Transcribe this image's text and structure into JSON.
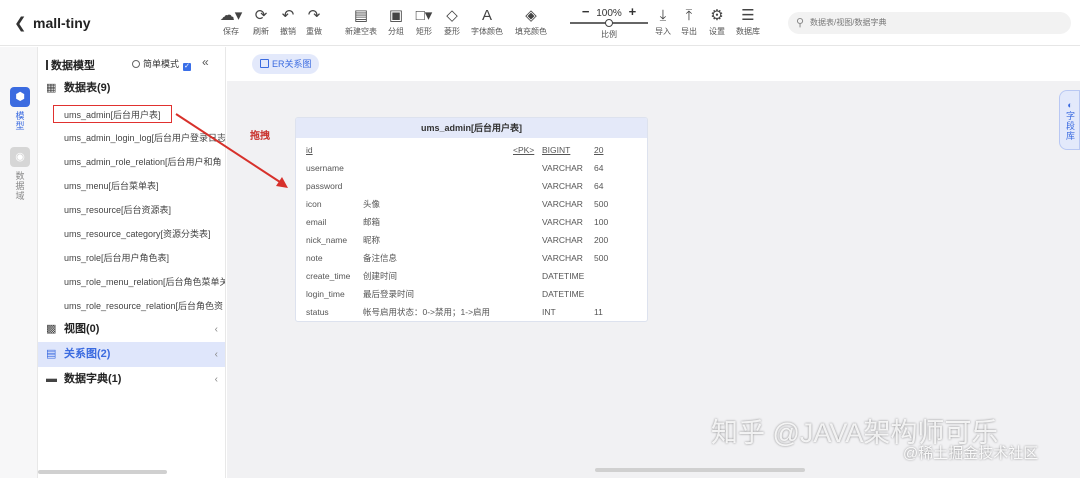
{
  "app": {
    "back_icon": "back-icon",
    "project_name": "mall-tiny"
  },
  "toolbar": {
    "tools": [
      {
        "icon": "save-icon",
        "label": "保存"
      },
      {
        "icon": "refresh-icon",
        "label": "刷新"
      },
      {
        "icon": "undo-icon",
        "label": "撤销"
      },
      {
        "icon": "redo-icon",
        "label": "重做"
      },
      {
        "icon": "new-blank-icon",
        "label": "新建空表"
      },
      {
        "icon": "group-icon",
        "label": "分组"
      },
      {
        "icon": "rectangle-icon",
        "label": "矩形"
      },
      {
        "icon": "diamond-icon",
        "label": "菱形"
      },
      {
        "icon": "font-color-icon",
        "label": "字体颜色"
      },
      {
        "icon": "fill-color-icon",
        "label": "填充颜色"
      },
      {
        "icon": "import-icon",
        "label": "导入"
      },
      {
        "icon": "export-icon",
        "label": "导出"
      },
      {
        "icon": "settings-icon",
        "label": "设置"
      },
      {
        "icon": "database-icon",
        "label": "数据库"
      }
    ],
    "zoom": {
      "minus": "−",
      "value": "100%",
      "plus": "+",
      "label": "比例",
      "level": 0.5
    },
    "search_placeholder": "数据表/视图/数据字典"
  },
  "rail": {
    "model": {
      "label": "模型",
      "icon": "cube-icon"
    },
    "data_domain": {
      "label": "数据域",
      "icon": "data-domain-icon"
    }
  },
  "sidebar": {
    "title": "数据模型",
    "simple_mode": "简单模式",
    "collapse": "«",
    "groups": {
      "tables": {
        "label": "数据表(9)",
        "icon": "table-icon"
      },
      "views": {
        "label": "视图(0)",
        "icon": "view-icon"
      },
      "relations": {
        "label": "关系图(2)",
        "icon": "relation-icon"
      },
      "dict": {
        "label": "数据字典(1)",
        "icon": "dictionary-icon"
      }
    },
    "arrow": "‹",
    "table_items": [
      "ums_admin[后台用户表]",
      "ums_admin_login_log[后台用户登录日志",
      "ums_admin_role_relation[后台用户和角",
      "ums_menu[后台菜单表]",
      "ums_resource[后台资源表]",
      "ums_resource_category[资源分类表]",
      "ums_role[后台用户角色表]",
      "ums_role_menu_relation[后台角色菜单关",
      "ums_role_resource_relation[后台角色资"
    ]
  },
  "canvas": {
    "tab_label": "ER关系图",
    "drag_label": "拖拽",
    "right_tab": "字段库",
    "entity": {
      "title": "ums_admin[后台用户表]",
      "fields": [
        {
          "name": "id",
          "comment": "",
          "key": "<PK>",
          "type": "BIGINT",
          "length": "20"
        },
        {
          "name": "username",
          "comment": "",
          "key": "",
          "type": "VARCHAR",
          "length": "64"
        },
        {
          "name": "password",
          "comment": "",
          "key": "",
          "type": "VARCHAR",
          "length": "64"
        },
        {
          "name": "icon",
          "comment": "头像",
          "key": "",
          "type": "VARCHAR",
          "length": "500"
        },
        {
          "name": "email",
          "comment": "邮箱",
          "key": "",
          "type": "VARCHAR",
          "length": "100"
        },
        {
          "name": "nick_name",
          "comment": "昵称",
          "key": "",
          "type": "VARCHAR",
          "length": "200"
        },
        {
          "name": "note",
          "comment": "备注信息",
          "key": "",
          "type": "VARCHAR",
          "length": "500"
        },
        {
          "name": "create_time",
          "comment": "创建时间",
          "key": "",
          "type": "DATETIME",
          "length": ""
        },
        {
          "name": "login_time",
          "comment": "最后登录时间",
          "key": "",
          "type": "DATETIME",
          "length": ""
        },
        {
          "name": "status",
          "comment": "帐号启用状态：0->禁用；1->启用",
          "key": "",
          "type": "INT",
          "length": "11"
        }
      ]
    },
    "watermark_line1": "知乎 @JAVA架构师可乐",
    "watermark_line2": "@稀土掘金技术社区"
  }
}
